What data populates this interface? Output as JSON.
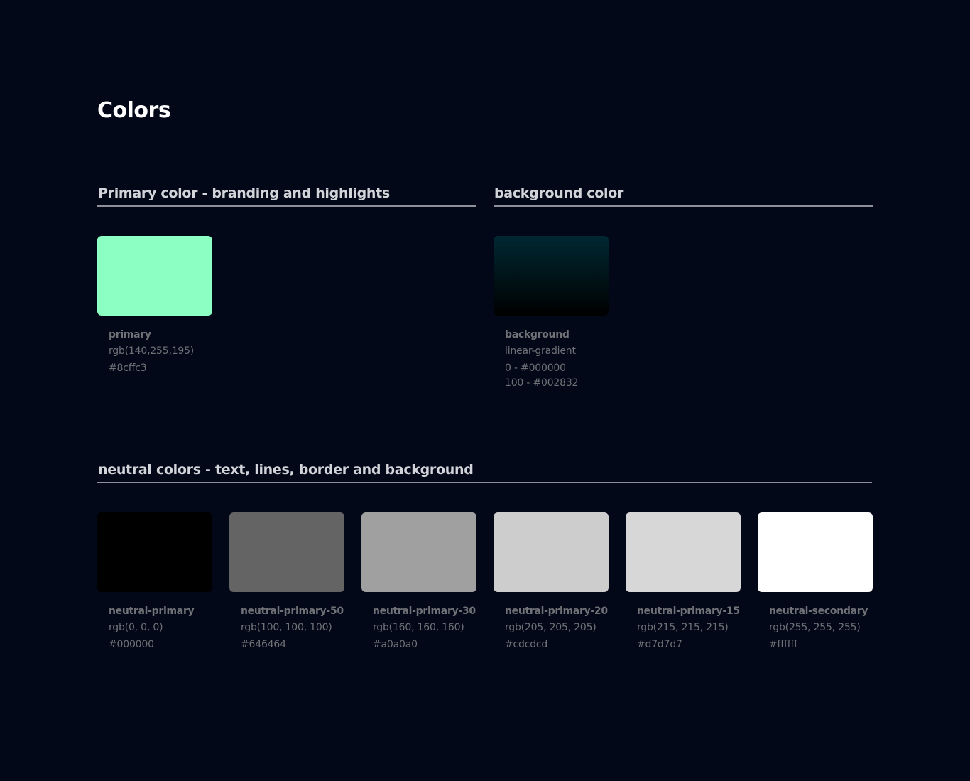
{
  "page": {
    "title": "Colors"
  },
  "sections": {
    "primary": {
      "heading": "Primary color - branding and highlights"
    },
    "background": {
      "heading": "background color"
    },
    "neutral": {
      "heading": "neutral colors - text, lines, border and background"
    }
  },
  "primary_swatch": {
    "name": "primary",
    "rgb": "rgb(140,255,195)",
    "hex": "#8cffc3",
    "color": "#8cffc3"
  },
  "background_swatch": {
    "name": "background",
    "type": "linear-gradient",
    "stop_0": "0 - #000000",
    "stop_100": "100 - #002832",
    "gradient_top": "#002832",
    "gradient_bottom": "#000000"
  },
  "neutral_swatches": [
    {
      "name": "neutral-primary",
      "rgb": "rgb(0, 0, 0)",
      "hex": "#000000",
      "color": "#000000"
    },
    {
      "name": "neutral-primary-50",
      "rgb": "rgb(100, 100, 100)",
      "hex": "#646464",
      "color": "#646464"
    },
    {
      "name": "neutral-primary-30",
      "rgb": "rgb(160, 160, 160)",
      "hex": "#a0a0a0",
      "color": "#a0a0a0"
    },
    {
      "name": "neutral-primary-20",
      "rgb": "rgb(205, 205, 205)",
      "hex": "#cdcdcd",
      "color": "#cdcdcd"
    },
    {
      "name": "neutral-primary-15",
      "rgb": "rgb(215, 215, 215)",
      "hex": "#d7d7d7",
      "color": "#d7d7d7"
    },
    {
      "name": "neutral-secondary",
      "rgb": "rgb(255, 255, 255)",
      "hex": "#ffffff",
      "color": "#ffffff"
    }
  ]
}
